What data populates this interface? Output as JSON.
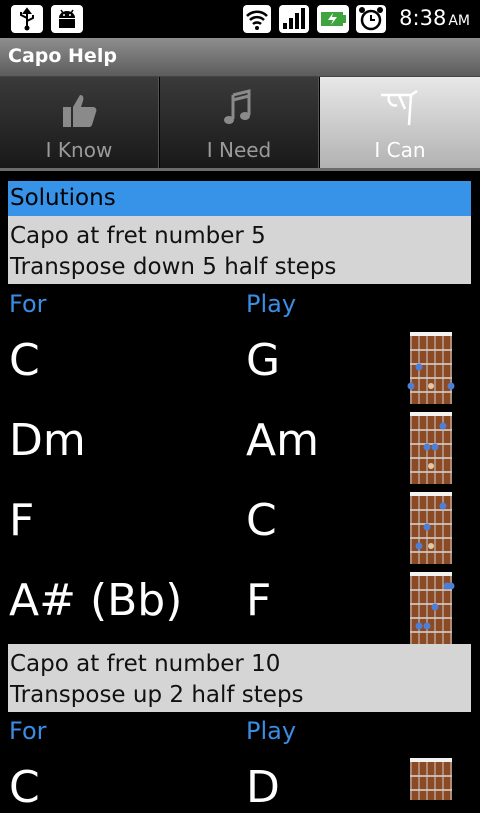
{
  "status_bar": {
    "time": "8:38",
    "ampm": "AM",
    "icons": [
      "usb-icon",
      "android-debug-icon",
      "wifi-icon",
      "signal-icon",
      "battery-charging-icon",
      "alarm-icon"
    ]
  },
  "title_bar": {
    "title": "Capo Help"
  },
  "tabs": [
    {
      "label": "I Know",
      "icon": "thumbs-up-icon",
      "selected": false
    },
    {
      "label": "I Need",
      "icon": "music-note-icon",
      "selected": false
    },
    {
      "label": "I Can",
      "icon": "capo-icon",
      "selected": true
    }
  ],
  "solutions": {
    "header": "Solutions",
    "items": [
      {
        "line1": "Capo at fret number 5",
        "line2": "Transpose down 5 half steps",
        "for_header": "For",
        "play_header": "Play",
        "rows": [
          {
            "for": "C",
            "play": "G",
            "diagram": "chord-diagram-g"
          },
          {
            "for": "Dm",
            "play": "Am",
            "diagram": "chord-diagram-am"
          },
          {
            "for": "F",
            "play": "C",
            "diagram": "chord-diagram-c"
          },
          {
            "for": "A# (Bb)",
            "play": "F",
            "diagram": "chord-diagram-f"
          }
        ]
      },
      {
        "line1": "Capo at fret number 10",
        "line2": "Transpose up 2 half steps",
        "for_header": "For",
        "play_header": "Play",
        "rows": [
          {
            "for": "C",
            "play": "D",
            "diagram": "chord-diagram-d"
          }
        ]
      }
    ]
  },
  "colors": {
    "accent": "#3693e8",
    "header_text": "#3a8de3",
    "box_bg": "#d5d5d5",
    "fret_wood": "#8c4a24",
    "dot_blue": "#4d7fd6"
  }
}
